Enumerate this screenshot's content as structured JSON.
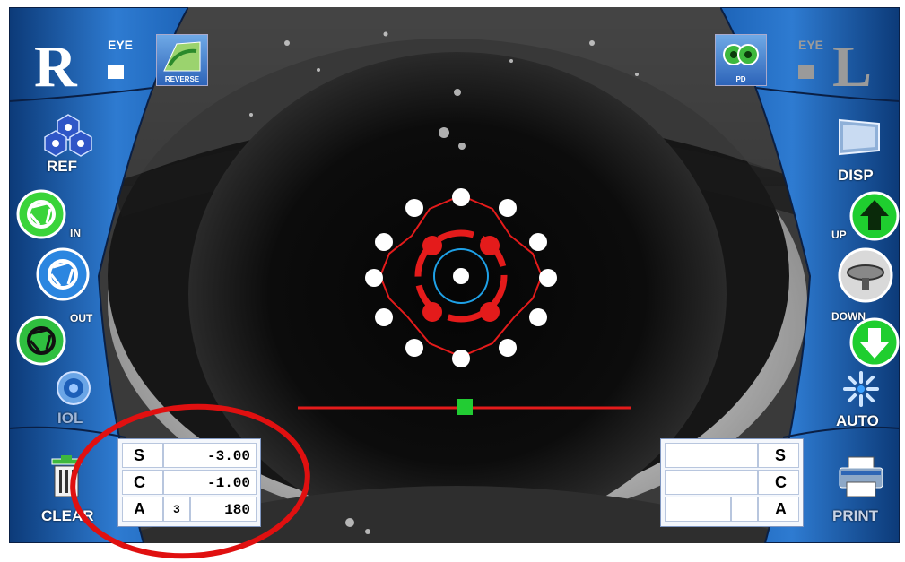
{
  "eyes": {
    "right": {
      "letter": "R",
      "label": "EYE"
    },
    "left": {
      "letter": "L",
      "label": "EYE"
    }
  },
  "top_buttons": {
    "reverse_label": "REVERSE",
    "pd_label": "PD"
  },
  "left_panel": {
    "ref_label": "REF",
    "in_label": "IN",
    "out_label": "OUT",
    "iol_label": "IOL",
    "clear_label": "CLEAR"
  },
  "right_panel": {
    "disp_label": "DISP",
    "up_label": "UP",
    "down_label": "DOWN",
    "auto_label": "AUTO",
    "print_label": "PRINT"
  },
  "right_eye_results": {
    "rows": [
      {
        "label": "S",
        "value": "-3.00"
      },
      {
        "label": "C",
        "value": "-1.00"
      },
      {
        "label": "A",
        "index": "3",
        "value": "180"
      }
    ]
  },
  "left_eye_results": {
    "rows": [
      {
        "label": "S",
        "value": ""
      },
      {
        "label": "C",
        "value": ""
      },
      {
        "label": "A",
        "index": "",
        "value": ""
      }
    ]
  },
  "colors": {
    "target_red": "#e41b1b",
    "pupil_ring_blue": "#1ea0e6",
    "alignment_marker_green": "#22cc33",
    "panel_blue": "#1d64b8",
    "highlight_circle": "#e01010"
  }
}
